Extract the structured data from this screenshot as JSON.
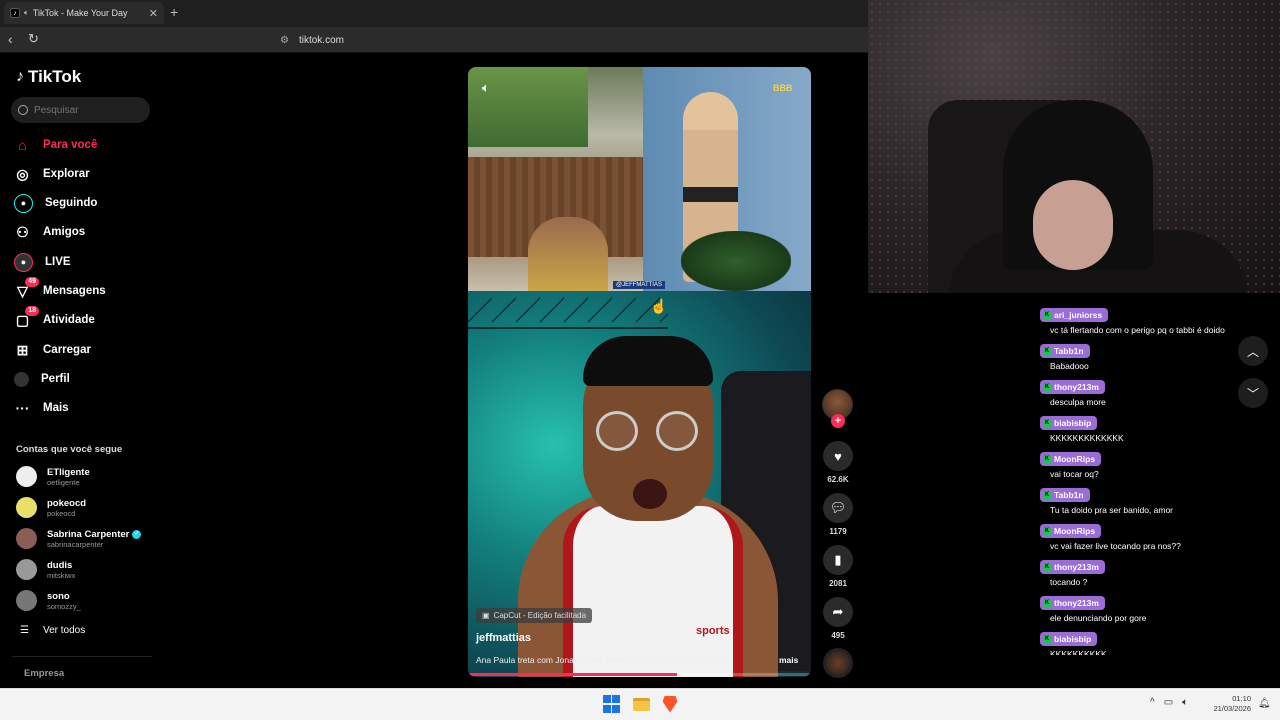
{
  "browser": {
    "tab_title": "TikTok - Make Your Day",
    "tab_close": "✕",
    "new_tab": "+",
    "url": "tiktok.com"
  },
  "sidebar": {
    "logo": "TikTok",
    "search_placeholder": "Pesquisar",
    "nav": [
      {
        "label": "Para você",
        "icon": "home-icon",
        "active": true
      },
      {
        "label": "Explorar",
        "icon": "compass-icon"
      },
      {
        "label": "Seguindo",
        "icon": "following-icon"
      },
      {
        "label": "Amigos",
        "icon": "friends-icon"
      },
      {
        "label": "LIVE",
        "icon": "live-icon"
      },
      {
        "label": "Mensagens",
        "icon": "messages-icon",
        "badge": "49"
      },
      {
        "label": "Atividade",
        "icon": "activity-icon",
        "badge": "18"
      },
      {
        "label": "Carregar",
        "icon": "upload-icon"
      },
      {
        "label": "Perfil",
        "icon": "profile-icon"
      },
      {
        "label": "Mais",
        "icon": "more-icon"
      }
    ],
    "following_title": "Contas que você segue",
    "accounts": [
      {
        "name": "ETligente",
        "handle": "oetligente"
      },
      {
        "name": "pokeocd",
        "handle": "pokeocd"
      },
      {
        "name": "Sabrina Carpenter",
        "handle": "sabrinacarpenter",
        "verified": true
      },
      {
        "name": "dudis",
        "handle": "mitskiwx"
      },
      {
        "name": "sono",
        "handle": "somozzy_"
      }
    ],
    "see_all": "Ver todos",
    "company": "Empresa"
  },
  "video": {
    "top_tag": "@JEFFMATTIAS",
    "bbb_logo": "BBB",
    "capcut": "CapCut - Edição facilitada",
    "author": "jeffmattias",
    "description": "Ana Paula treta com Jonas e com Milena sobre o vestido da última",
    "more": "mais",
    "shirt_text": "sports",
    "progress": 0.61
  },
  "actions": {
    "likes": "62.6K",
    "comments": "1179",
    "saves": "2081",
    "shares": "495"
  },
  "chat": {
    "messages": [
      {
        "user": "ari_juniorss",
        "text": "vc tá flertando com o perigo pq o tabbi é doido"
      },
      {
        "user": "Tabb1n",
        "text": "Babadooo"
      },
      {
        "user": "thony213m",
        "text": "desculpa more"
      },
      {
        "user": "biabisbip",
        "text": "KKKKKKKKKKKKK"
      },
      {
        "user": "MoonRips",
        "text": "vai tocar oq?"
      },
      {
        "user": "Tabb1n",
        "text": "Tu ta doido pra ser banido, amor"
      },
      {
        "user": "MoonRips",
        "text": "vc vai fazer live tocando pra nos??"
      },
      {
        "user": "thony213m",
        "text": "tocando ?"
      },
      {
        "user": "thony213m",
        "text": "ele denunciando por gore"
      },
      {
        "user": "biabisbip",
        "text": "KKKKKKKKKK"
      },
      {
        "user": "Tabb1n",
        "text": ""
      }
    ]
  },
  "taskbar": {
    "time": "01:10",
    "date": "21/03/2026"
  },
  "colors": {
    "accent": "#fe2c55",
    "chat_badge": "#9b6bd6"
  }
}
